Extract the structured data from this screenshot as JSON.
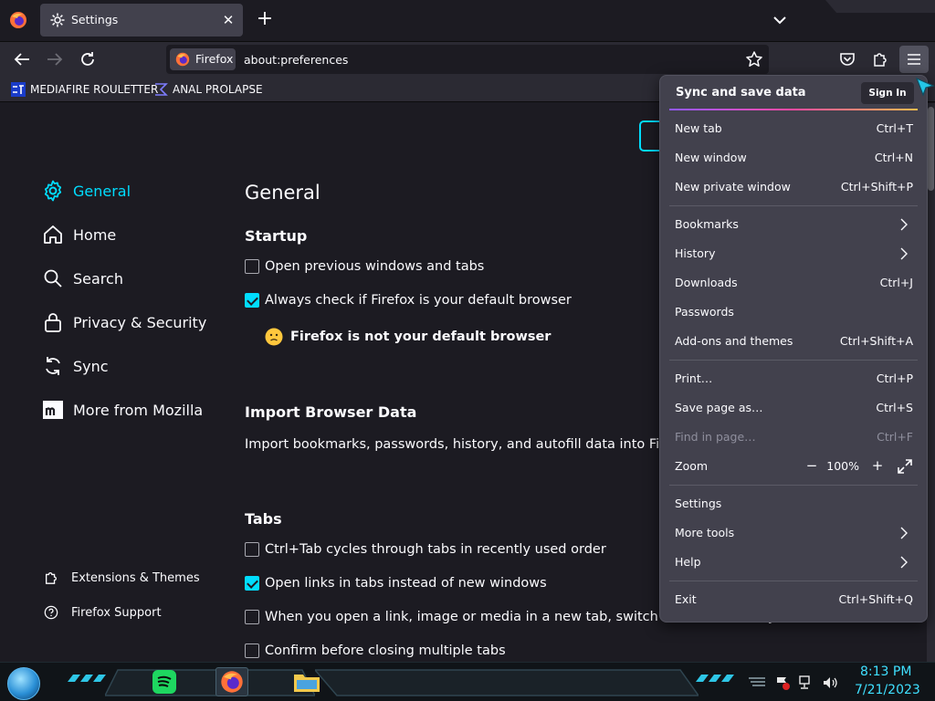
{
  "tab": {
    "title": "Settings",
    "close": "✕"
  },
  "new_tab": "+",
  "urlbar": {
    "identity_label": "Firefox",
    "url": "about:preferences"
  },
  "bookmarks": [
    {
      "label": "MEDIAFIRE ROULETTER"
    },
    {
      "label": "ANAL PROLAPSE"
    }
  ],
  "sidebar": {
    "categories": [
      {
        "label": "General",
        "icon": "gear-icon",
        "selected": true
      },
      {
        "label": "Home",
        "icon": "home-icon"
      },
      {
        "label": "Search",
        "icon": "search-icon"
      },
      {
        "label": "Privacy & Security",
        "icon": "lock-icon"
      },
      {
        "label": "Sync",
        "icon": "sync-icon"
      },
      {
        "label": "More from Mozilla",
        "icon": "mozilla-icon"
      }
    ],
    "footer": [
      {
        "label": "Extensions & Themes",
        "icon": "puzzle-icon"
      },
      {
        "label": "Firefox Support",
        "icon": "help-icon"
      }
    ]
  },
  "general": {
    "title": "General",
    "startup": {
      "heading": "Startup",
      "open_previous": {
        "label": "Open previous windows and tabs",
        "checked": false
      },
      "always_check": {
        "label": "Always check if Firefox is your default browser",
        "checked": true
      },
      "not_default_msg": "Firefox is not your default browser"
    },
    "import": {
      "heading": "Import Browser Data",
      "description": "Import bookmarks, passwords, history, and autofill data into Firefox."
    },
    "tabs": {
      "heading": "Tabs",
      "options": [
        {
          "label": "Ctrl+Tab cycles through tabs in recently used order",
          "checked": false
        },
        {
          "label": "Open links in tabs instead of new windows",
          "checked": true
        },
        {
          "label": "When you open a link, image or media in a new tab, switch to it immediately",
          "checked": false
        },
        {
          "label": "Confirm before closing multiple tabs",
          "checked": false
        }
      ]
    }
  },
  "app_menu": {
    "sync_label": "Sync and save data",
    "sign_in": "Sign In",
    "items": {
      "new_tab": {
        "label": "New tab",
        "shortcut": "Ctrl+T"
      },
      "new_window": {
        "label": "New window",
        "shortcut": "Ctrl+N"
      },
      "new_private_window": {
        "label": "New private window",
        "shortcut": "Ctrl+Shift+P"
      },
      "bookmarks": {
        "label": "Bookmarks"
      },
      "history": {
        "label": "History"
      },
      "downloads": {
        "label": "Downloads",
        "shortcut": "Ctrl+J"
      },
      "passwords": {
        "label": "Passwords"
      },
      "addons": {
        "label": "Add-ons and themes",
        "shortcut": "Ctrl+Shift+A"
      },
      "print": {
        "label": "Print…",
        "shortcut": "Ctrl+P"
      },
      "save_page": {
        "label": "Save page as…",
        "shortcut": "Ctrl+S"
      },
      "find": {
        "label": "Find in page…",
        "shortcut": "Ctrl+F",
        "disabled": true
      },
      "zoom": {
        "label": "Zoom",
        "minus": "−",
        "value": "100%",
        "plus": "+"
      },
      "settings": {
        "label": "Settings"
      },
      "more_tools": {
        "label": "More tools"
      },
      "help": {
        "label": "Help"
      },
      "exit": {
        "label": "Exit",
        "shortcut": "Ctrl+Shift+Q"
      }
    }
  },
  "taskbar": {
    "apps": [
      "spotify-icon",
      "firefox-icon",
      "file-explorer-icon"
    ],
    "time": "8:13 PM",
    "date": "7/21/2023"
  },
  "colors": {
    "accent": "#00ddff",
    "menu_bg": "#42414d",
    "page_bg": "#1c1b22",
    "toolbar_bg": "#2b2a33",
    "clock": "#3fe0ff"
  }
}
